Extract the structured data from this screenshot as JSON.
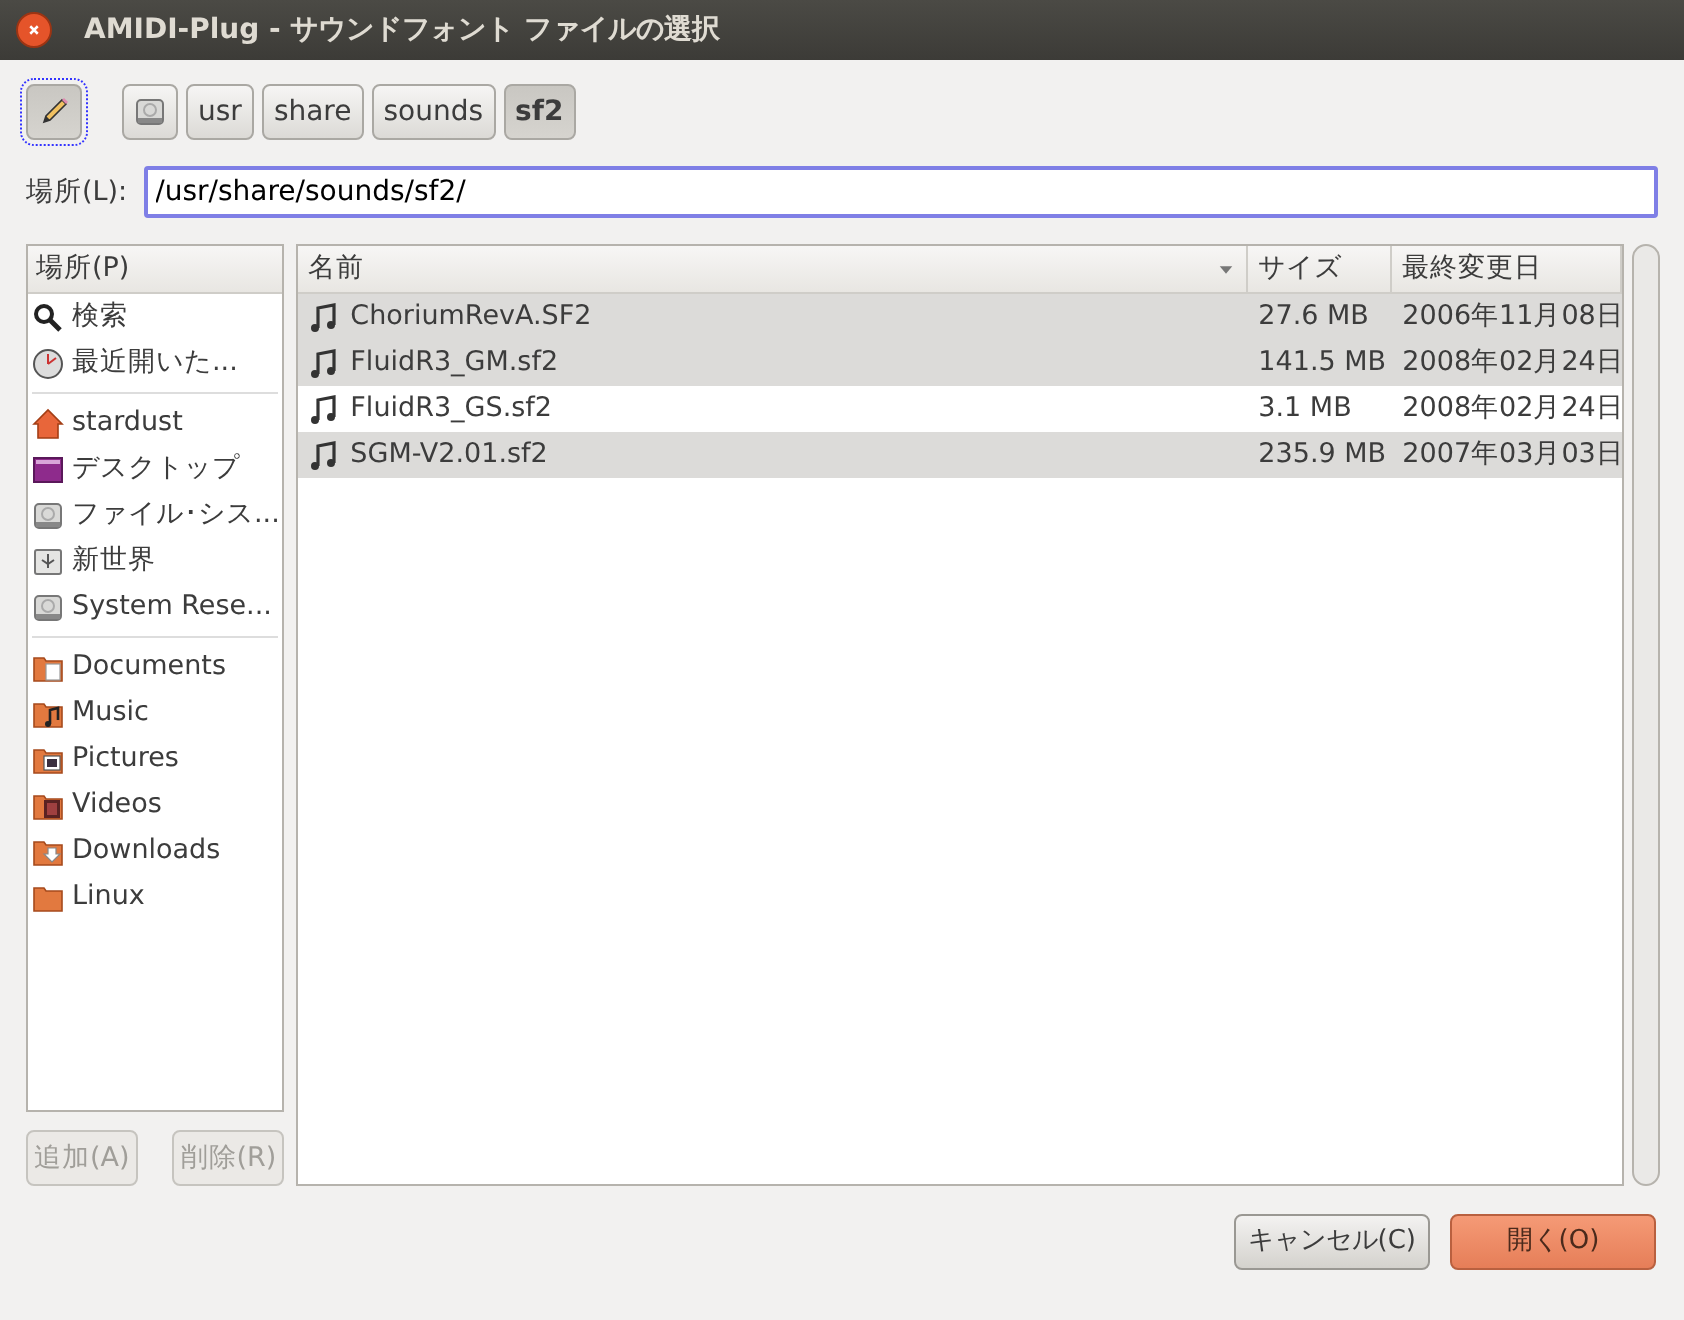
{
  "window": {
    "title": "AMIDI-Plug - サウンドフォント ファイルの選択"
  },
  "path_bar": {
    "edit_toggle": {
      "on": true
    },
    "buttons": [
      {
        "kind": "drive",
        "selected": false
      },
      {
        "kind": "folder",
        "label": "usr",
        "selected": false
      },
      {
        "kind": "folder",
        "label": "share",
        "selected": false
      },
      {
        "kind": "folder",
        "label": "sounds",
        "selected": false
      },
      {
        "kind": "folder",
        "label": "sf2",
        "selected": true
      }
    ]
  },
  "location": {
    "label": "場所(L):",
    "value": "/usr/share/sounds/sf2/"
  },
  "places": {
    "header": "場所(P)",
    "groups": [
      [
        {
          "kind": "search",
          "label": "検索"
        },
        {
          "kind": "recent",
          "label": "最近開いた..."
        }
      ],
      [
        {
          "kind": "home",
          "label": "stardust"
        },
        {
          "kind": "desktop",
          "label": "デスクトップ"
        },
        {
          "kind": "drive",
          "label": "ファイル･シス..."
        },
        {
          "kind": "usb",
          "label": "新世界"
        },
        {
          "kind": "drive",
          "label": "System Rese..."
        }
      ],
      [
        {
          "kind": "documents",
          "label": "Documents"
        },
        {
          "kind": "music",
          "label": "Music"
        },
        {
          "kind": "pictures",
          "label": "Pictures"
        },
        {
          "kind": "videos",
          "label": "Videos"
        },
        {
          "kind": "downloads",
          "label": "Downloads"
        },
        {
          "kind": "folder",
          "label": "Linux"
        }
      ]
    ],
    "buttons": [
      {
        "label": "追加(A)",
        "disabled": true
      },
      {
        "label": "削除(R)",
        "disabled": true
      }
    ]
  },
  "files": {
    "columns": [
      "名前",
      "サイズ",
      "最終変更日"
    ],
    "rows": [
      {
        "name": "ChoriumRevA.SF2",
        "size": "27.6 MB",
        "modified": "2006年11月08日",
        "selected": true
      },
      {
        "name": "FluidR3_GM.sf2",
        "size": "141.5 MB",
        "modified": "2008年02月24日",
        "selected": true
      },
      {
        "name": "FluidR3_GS.sf2",
        "size": "3.1 MB",
        "modified": "2008年02月24日",
        "selected": false
      },
      {
        "name": "SGM-V2.01.sf2",
        "size": "235.9 MB",
        "modified": "2007年03月03日",
        "selected": true
      }
    ]
  },
  "buttons": [
    {
      "kind": "cancel",
      "label": "キャンセル(C)"
    },
    {
      "kind": "open",
      "label": "開く(O)"
    }
  ]
}
